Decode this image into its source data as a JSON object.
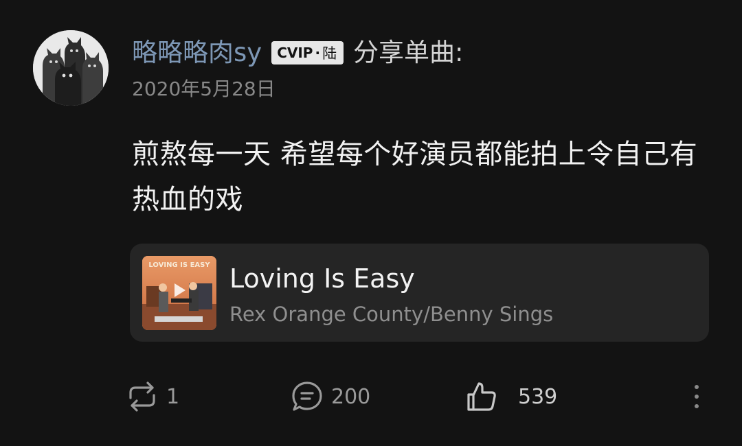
{
  "post": {
    "username": "略略略肉sy",
    "vip_badge": {
      "text": "CVIP",
      "separator": "·",
      "level": "陆"
    },
    "share_label": "分享单曲:",
    "date": "2020年5月28日",
    "content": "煎熬每一天 希望每个好演员都能拍上令自己有热血的戏"
  },
  "song_card": {
    "title": "Loving Is Easy",
    "artist": "Rex Orange County/Benny Sings",
    "cover_text": "LOVING IS EASY"
  },
  "actions": {
    "share_count": "1",
    "comment_count": "200",
    "like_count": "539"
  },
  "colors": {
    "background": "#131313",
    "username": "#7d97b5",
    "card": "#252525",
    "muted": "#9a9a9a"
  }
}
